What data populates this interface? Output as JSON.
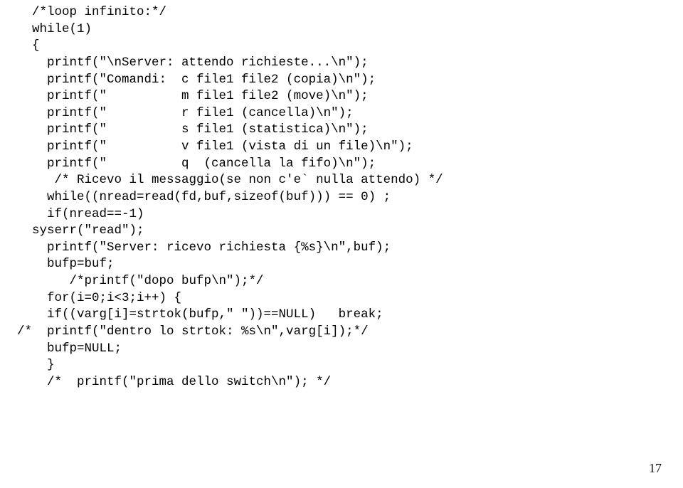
{
  "code": {
    "lines": [
      "  /*loop infinito:*/",
      "  while(1)",
      "  {",
      "    printf(\"\\nServer: attendo richieste...\\n\");",
      "    printf(\"Comandi:  c file1 file2 (copia)\\n\");",
      "    printf(\"          m file1 file2 (move)\\n\");",
      "    printf(\"          r file1 (cancella)\\n\");",
      "    printf(\"          s file1 (statistica)\\n\");",
      "    printf(\"          v file1 (vista di un file)\\n\");",
      "    printf(\"          q  (cancella la fifo)\\n\");",
      "     /* Ricevo il messaggio(se non c'e` nulla attendo) */",
      "    while((nread=read(fd,buf,sizeof(buf))) == 0) ;",
      "    if(nread==-1)",
      "  syserr(\"read\");",
      "    printf(\"Server: ricevo richiesta {%s}\\n\",buf);",
      "    bufp=buf;",
      "       /*printf(\"dopo bufp\\n\");*/",
      "    for(i=0;i<3;i++) {",
      "    if((varg[i]=strtok(bufp,\" \"))==NULL)   break;",
      "/*  printf(\"dentro lo strtok: %s\\n\",varg[i]);*/",
      "    bufp=NULL;",
      "    }",
      "    /*  printf(\"prima dello switch\\n\"); */"
    ]
  },
  "page_number": "17"
}
